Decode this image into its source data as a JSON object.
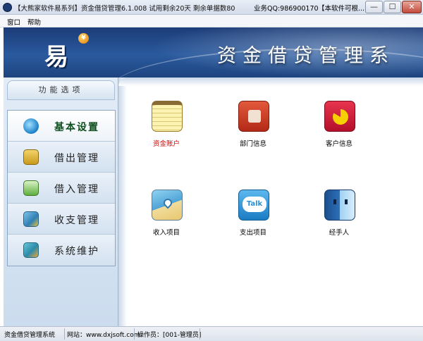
{
  "window": {
    "title": "【大熊家软件易系列】资金借贷管理6.1.008  试用剩余20天  剩余单据数80",
    "qq": "业务QQ:986900170",
    "notice": "【本软件可根...",
    "min_symbol": "—",
    "max_symbol": "☐",
    "close_symbol": "✕"
  },
  "menu": {
    "items": [
      "窗口",
      "帮助"
    ]
  },
  "banner": {
    "logo_text": "易",
    "coin_symbol": "¥",
    "title": "资金借贷管理系"
  },
  "sidebar": {
    "header": "功能选项",
    "items": [
      {
        "label": "基本设置",
        "icon": "globe-gear-icon",
        "active": true
      },
      {
        "label": "借出管理",
        "icon": "money-drawer-icon",
        "active": false
      },
      {
        "label": "借入管理",
        "icon": "inbox-icon",
        "active": false
      },
      {
        "label": "收支管理",
        "icon": "ledger-icon",
        "active": false
      },
      {
        "label": "系统维护",
        "icon": "maintenance-icon",
        "active": false
      }
    ]
  },
  "tiles": [
    {
      "label": "资金账户",
      "icon": "notepad-icon",
      "color": "#d40000"
    },
    {
      "label": "部门信息",
      "icon": "puzzle-icon",
      "color": "#000000"
    },
    {
      "label": "客户信息",
      "icon": "pacman-icon",
      "color": "#000000"
    },
    {
      "label": "收入项目",
      "icon": "map-pin-icon",
      "color": "#000000"
    },
    {
      "label": "支出项目",
      "icon": "talk-bubble-icon",
      "color": "#000000",
      "icon_text": "Talk"
    },
    {
      "label": "经手人",
      "icon": "finder-face-icon",
      "color": "#000000"
    }
  ],
  "status": {
    "app": "资金借贷管理系统",
    "site": "网站：www.dxjsoft.com",
    "operator": "操作员：[001-管理员]"
  }
}
